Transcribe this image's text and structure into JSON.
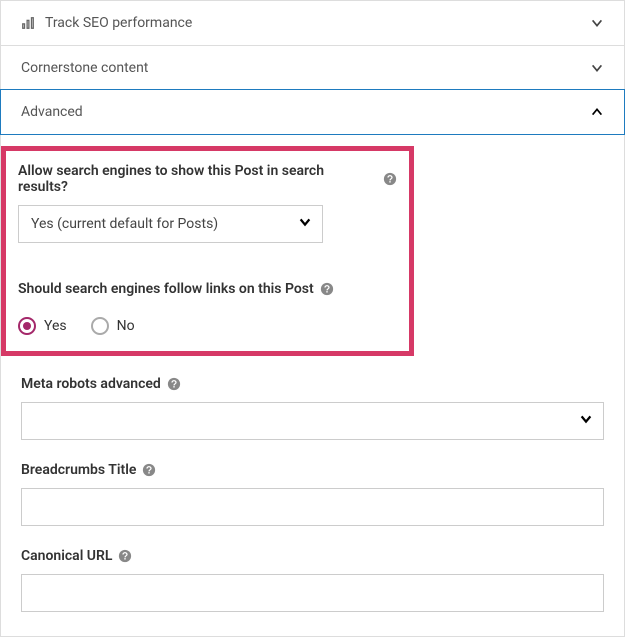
{
  "sections": {
    "seo": {
      "title": "Track SEO performance"
    },
    "cornerstone": {
      "title": "Cornerstone content"
    },
    "advanced": {
      "title": "Advanced"
    }
  },
  "advanced": {
    "allowSearch": {
      "label": "Allow search engines to show this Post in search results?",
      "selectValue": "Yes (current default for Posts)"
    },
    "followLinks": {
      "label": "Should search engines follow links on this Post",
      "optionYes": "Yes",
      "optionNo": "No",
      "selected": "yes"
    },
    "metaRobots": {
      "label": "Meta robots advanced",
      "value": ""
    },
    "breadcrumbs": {
      "label": "Breadcrumbs Title",
      "value": ""
    },
    "canonical": {
      "label": "Canonical URL",
      "value": ""
    }
  }
}
